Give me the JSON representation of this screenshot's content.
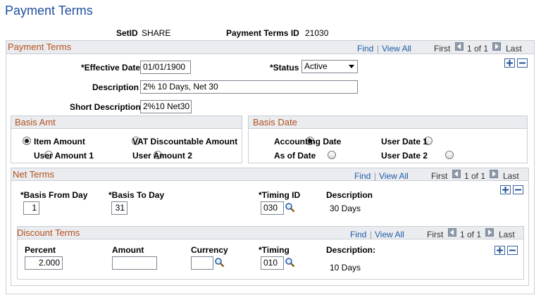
{
  "page": {
    "title": "Payment Terms"
  },
  "header": {
    "setid_label": "SetID",
    "setid_value": "SHARE",
    "ptid_label": "Payment Terms ID",
    "ptid_value": "21030"
  },
  "payment_terms": {
    "section_title": "Payment Terms",
    "nav": {
      "find": "Find",
      "sep": "|",
      "view_all": "View All",
      "first": "First",
      "count": "1 of 1",
      "last": "Last"
    },
    "effective_date_label": "*Effective Date",
    "effective_date_value": "01/01/1900",
    "status_label": "*Status",
    "status_value": "Active",
    "description_label": "Description",
    "description_value": "2% 10 Days, Net 30",
    "short_description_label": "Short Description",
    "short_description_value": "2%10 Net30"
  },
  "basis_amt": {
    "section_title": "Basis Amt",
    "options": [
      "Item Amount",
      "VAT Discountable Amount",
      "User Amount 1",
      "User Amount 2"
    ],
    "selected": "Item Amount"
  },
  "basis_date": {
    "section_title": "Basis Date",
    "options": [
      "Accounting Date",
      "User Date 1",
      "As of Date",
      "User Date 2"
    ],
    "selected": "Accounting Date"
  },
  "net_terms": {
    "section_title": "Net Terms",
    "nav": {
      "find": "Find",
      "sep": "|",
      "view_all": "View All",
      "first": "First",
      "count": "1 of 1",
      "last": "Last"
    },
    "basis_from_day_label": "*Basis From Day",
    "basis_from_day_value": "1",
    "basis_to_day_label": "*Basis To Day",
    "basis_to_day_value": "31",
    "timing_id_label": "*Timing ID",
    "timing_id_value": "030",
    "description_label": "Description",
    "description_value": "30 Days"
  },
  "discount_terms": {
    "section_title": "Discount Terms",
    "nav": {
      "find": "Find",
      "sep": "|",
      "view_all": "View All",
      "first": "First",
      "count": "1 of 1",
      "last": "Last"
    },
    "percent_label": "Percent",
    "percent_value": "2.000",
    "amount_label": "Amount",
    "amount_value": "",
    "currency_label": "Currency",
    "currency_value": "",
    "timing_label": "*Timing",
    "timing_value": "010",
    "description_label": "Description:",
    "description_value": "10 Days"
  },
  "colors": {
    "title": "#1f4f9c",
    "section_title": "#b4501e",
    "link": "#1f5ca8",
    "header_bg": "#eaecef",
    "border": "#c9cfd6"
  },
  "icons": [
    "first-arrow-icon",
    "last-arrow-icon",
    "add-row-icon",
    "delete-row-icon",
    "lookup-icon",
    "dropdown-arrow-icon",
    "radio-icon"
  ]
}
